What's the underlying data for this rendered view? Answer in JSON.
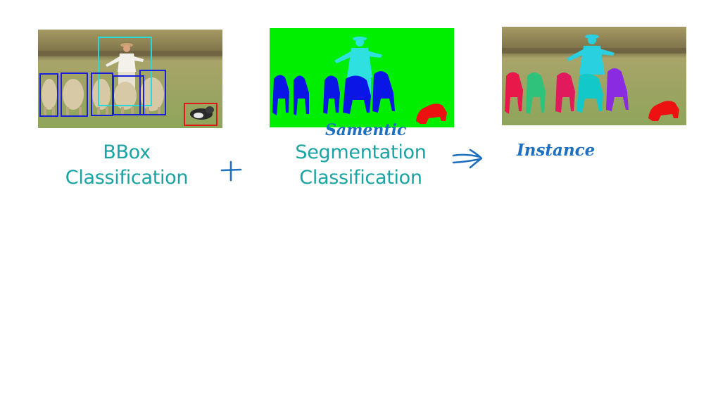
{
  "captions": {
    "bbox": [
      "BBox",
      "Classification"
    ],
    "semantic": [
      "Segmentation",
      "Classification"
    ]
  },
  "handwritten": {
    "semantic": "Samentic",
    "instance": "Instance"
  },
  "colors": {
    "caption_teal": "#1aa3a3",
    "ink_blue": "#1e6fc0",
    "seg_background": "#00ee00",
    "sheep_blue": "#0a16e6",
    "person_cyan": "#2ee0e0",
    "dog_red": "#ee1111",
    "instance_colors": [
      "#e8194a",
      "#2ec27a",
      "#e01a5c",
      "#12c8c8",
      "#8a2be2",
      "#ee1111",
      "#28d0e0"
    ]
  },
  "icons": {
    "plus": "plus-icon",
    "arrow": "double-arrow-icon"
  }
}
